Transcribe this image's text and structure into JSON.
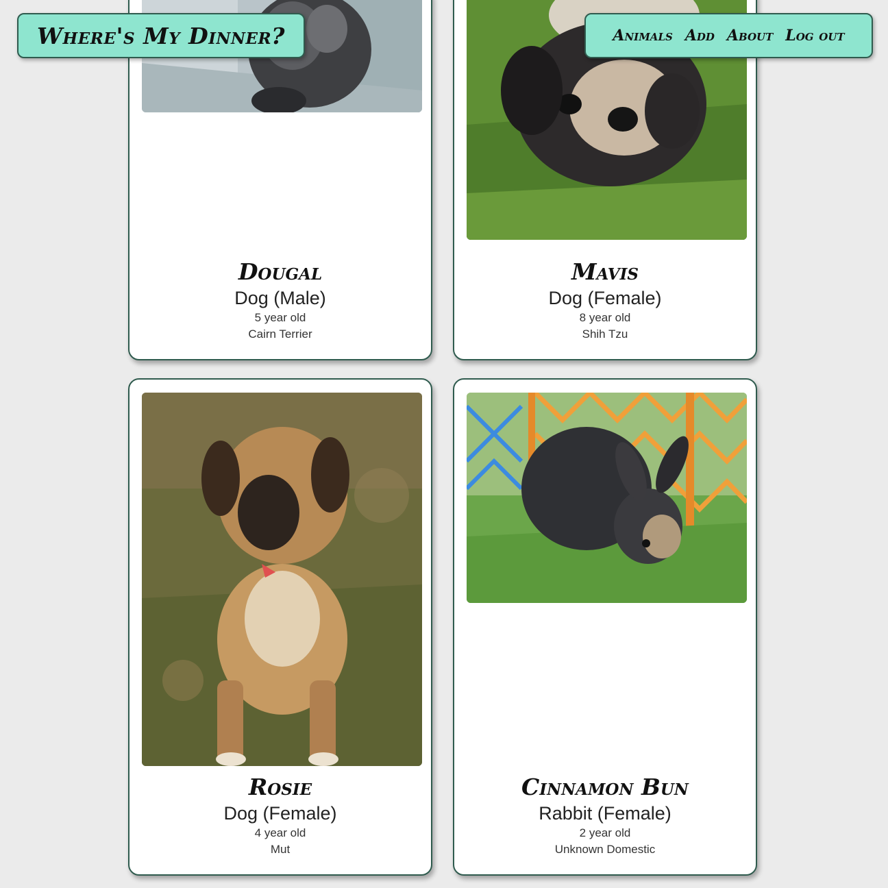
{
  "header": {
    "brand": "Where's My Dinner?",
    "nav": [
      {
        "label": "Animals"
      },
      {
        "label": "Add"
      },
      {
        "label": "About"
      },
      {
        "label": "Log out"
      }
    ]
  },
  "animals": [
    {
      "name": "Dougal",
      "type": "Dog (Male)",
      "age": "5 year old",
      "breed": "Cairn Terrier"
    },
    {
      "name": "Mavis",
      "type": "Dog (Female)",
      "age": "8 year old",
      "breed": "Shih Tzu"
    },
    {
      "name": "Rosie",
      "type": "Dog (Female)",
      "age": "4 year old",
      "breed": "Mut"
    },
    {
      "name": "Cinnamon Bun",
      "type": "Rabbit (Female)",
      "age": "2 year old",
      "breed": "Unknown Domestic"
    }
  ],
  "colors": {
    "accent": "#8ee5cf",
    "border": "#2f5b4e",
    "background": "#ebebeb",
    "card": "#ffffff"
  }
}
